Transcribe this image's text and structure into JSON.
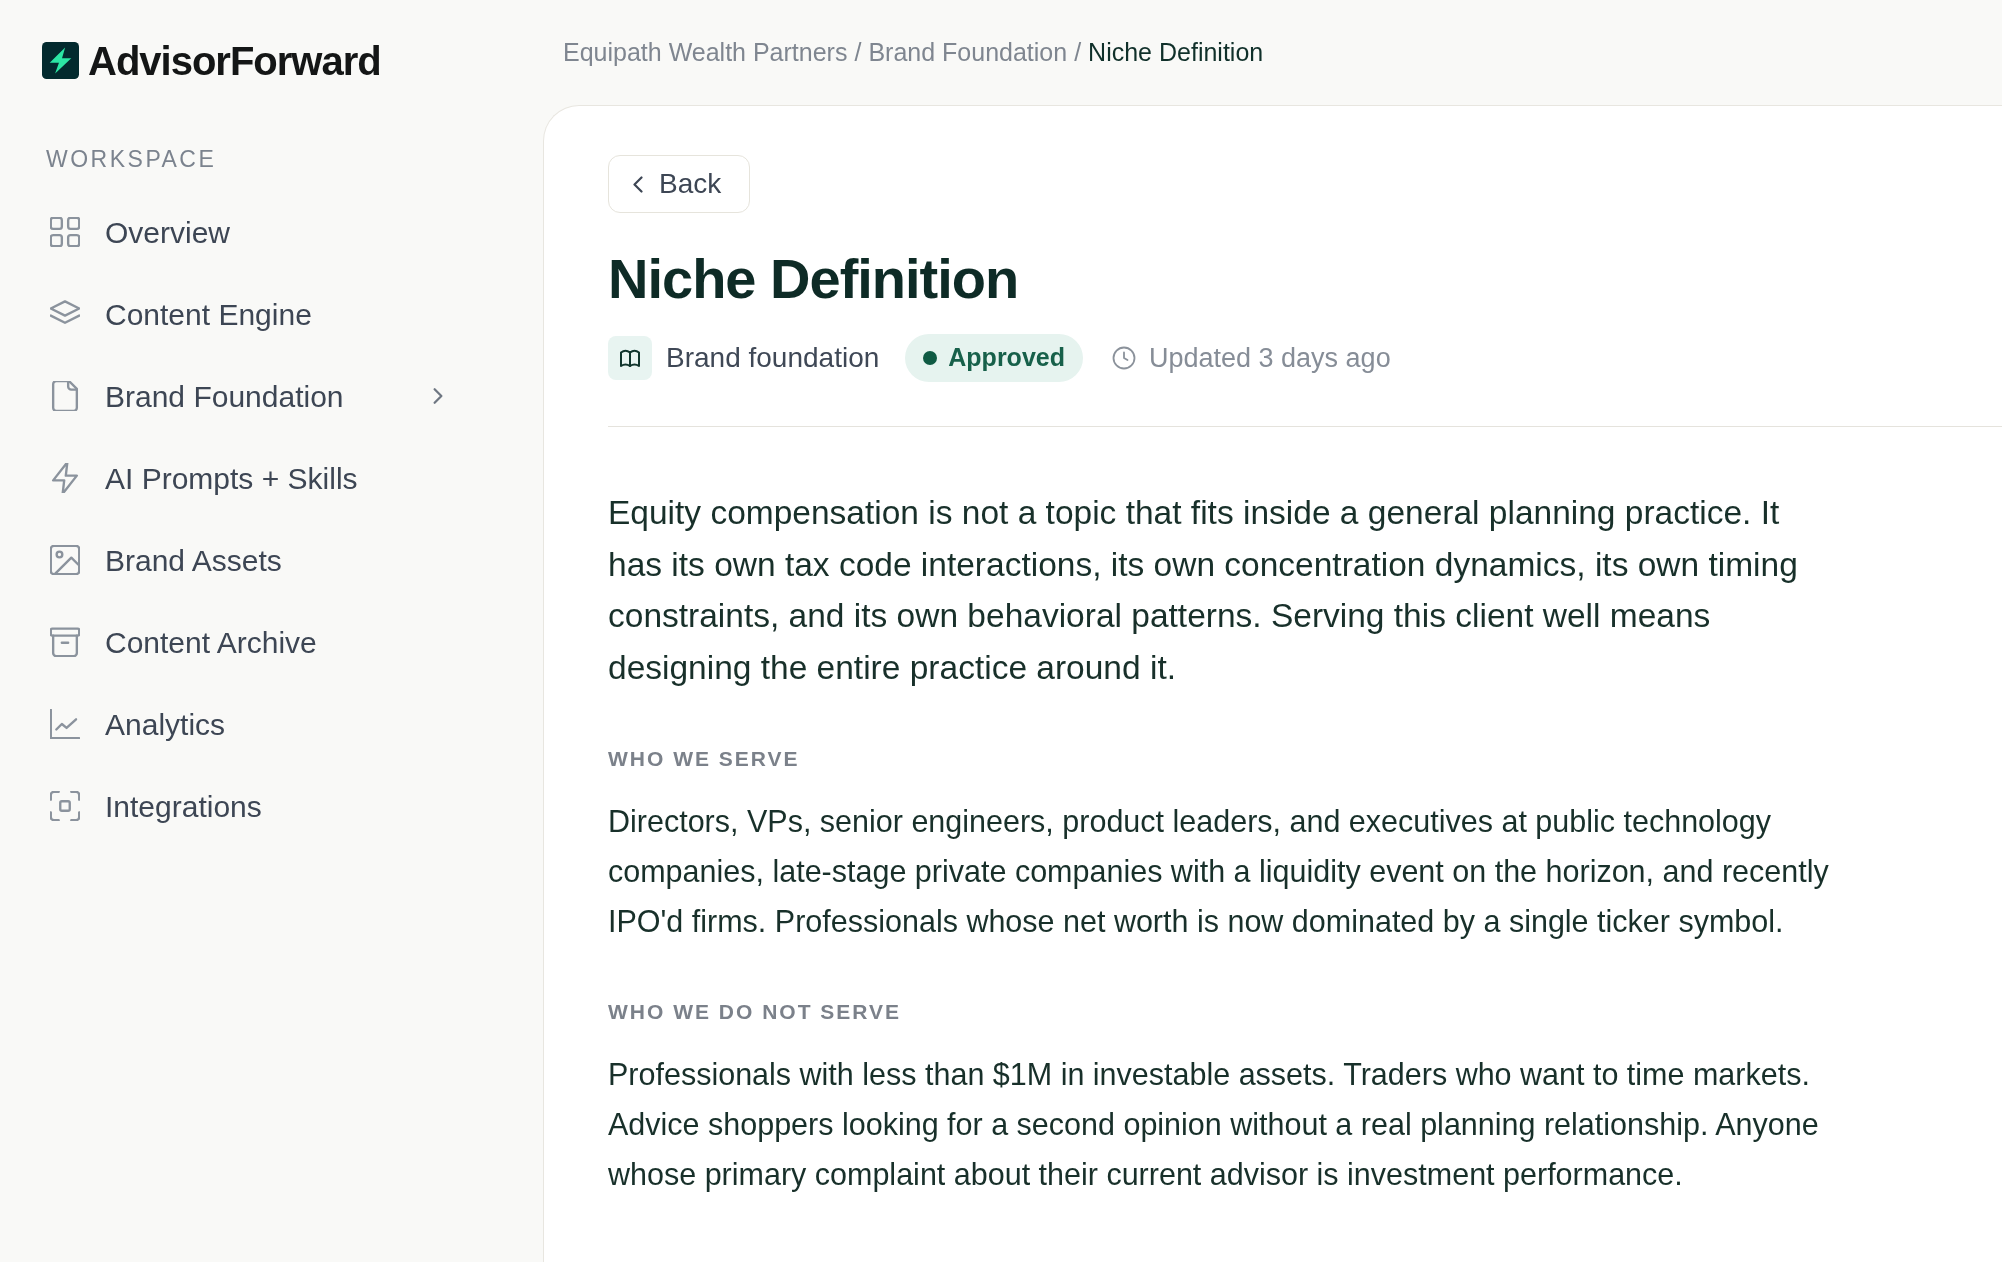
{
  "brand": {
    "name": "AdvisorForward"
  },
  "sidebar": {
    "section_label": "WORKSPACE",
    "items": [
      {
        "label": "Overview",
        "kind": "link",
        "selected": false
      },
      {
        "label": "Content Engine",
        "kind": "link",
        "selected": false
      },
      {
        "label": "Brand Foundation",
        "kind": "group",
        "expanded": false,
        "selected": false
      },
      {
        "label": "AI Prompts + Skills",
        "kind": "link",
        "selected": false
      },
      {
        "label": "Brand Assets",
        "kind": "link",
        "selected": false
      },
      {
        "label": "Content Archive",
        "kind": "link",
        "selected": false
      },
      {
        "label": "Analytics",
        "kind": "link",
        "selected": false
      },
      {
        "label": "Integrations",
        "kind": "link",
        "selected": false
      }
    ]
  },
  "breadcrumb": [
    {
      "label": "Equipath Wealth Partners",
      "current": false
    },
    {
      "separator": "/",
      "label": "Brand Foundation",
      "current": false
    },
    {
      "separator": "/",
      "label": "Niche Definition",
      "current": true
    }
  ],
  "page": {
    "back_button": {
      "label": "Back"
    },
    "title": "Niche Definition",
    "meta": {
      "category": "Brand foundation",
      "status": {
        "label": "Approved",
        "kind": "approved"
      },
      "updated": "Updated 3 days ago"
    },
    "intro": "Equity compensation is not a topic that fits inside a general planning practice. It has its own tax code interactions, its own concentration dynamics, its own timing constraints, and its own behavioral patterns. Serving this client well means designing the entire practice around it.",
    "sections": [
      {
        "heading": "WHO WE SERVE",
        "body": "Directors, VPs, senior engineers, product leaders, and executives at public technology companies, late-stage private companies with a liquidity event on the horizon, and recently IPO'd firms. Professionals whose net worth is now dominated by a single ticker symbol."
      },
      {
        "heading": "WHO WE DO NOT SERVE",
        "body": "Professionals with less than $1M in investable assets. Traders who want to time markets. Advice shoppers looking for a second opinion without a real planning relationship. Anyone whose primary complaint about their current advisor is investment performance."
      }
    ]
  }
}
